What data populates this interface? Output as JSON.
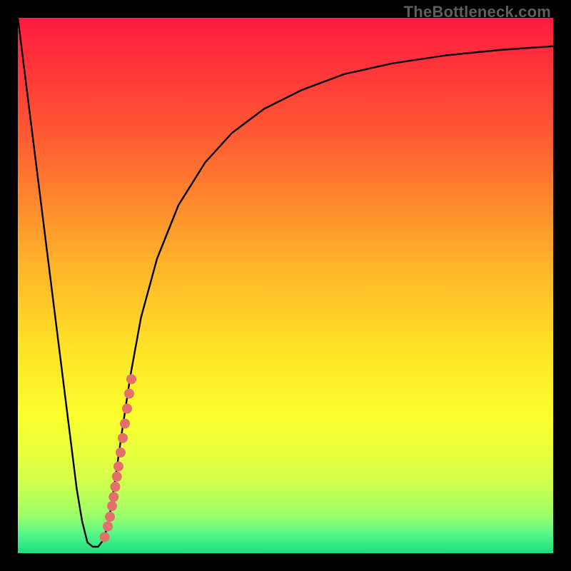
{
  "watermark": "TheBottleneck.com",
  "chart_data": {
    "type": "line",
    "title": "",
    "xlabel": "",
    "ylabel": "",
    "xlim": [
      0,
      100
    ],
    "ylim": [
      0,
      100
    ],
    "grid": false,
    "legend": false,
    "gradient_stops": [
      {
        "offset": 0.0,
        "color": "#ff1a3f"
      },
      {
        "offset": 0.22,
        "color": "#ff5a33"
      },
      {
        "offset": 0.45,
        "color": "#ffb02a"
      },
      {
        "offset": 0.62,
        "color": "#ffe326"
      },
      {
        "offset": 0.75,
        "color": "#fbff2e"
      },
      {
        "offset": 0.86,
        "color": "#d7ff4a"
      },
      {
        "offset": 0.93,
        "color": "#9cff69"
      },
      {
        "offset": 0.965,
        "color": "#55f58a"
      },
      {
        "offset": 1.0,
        "color": "#18e07d"
      }
    ],
    "series": [
      {
        "name": "bottleneck-curve",
        "color": "#000000",
        "x": [
          0.0,
          2.0,
          4.0,
          6.0,
          8.0,
          10.0,
          11.0,
          12.0,
          13.0,
          14.0,
          15.0,
          16.0,
          17.0,
          18.0,
          19.5,
          21.0,
          23.0,
          26.0,
          30.0,
          35.0,
          40.0,
          46.0,
          53.0,
          61.0,
          70.0,
          80.0,
          90.0,
          100.0
        ],
        "y": [
          100.0,
          84.0,
          68.0,
          52.0,
          36.0,
          20.0,
          12.0,
          6.0,
          2.0,
          1.2,
          1.2,
          2.5,
          6.0,
          12.5,
          23.0,
          33.0,
          44.0,
          55.0,
          65.0,
          73.0,
          78.5,
          83.0,
          86.5,
          89.5,
          91.5,
          93.0,
          94.0,
          94.7
        ]
      }
    ],
    "scatter": {
      "name": "highlight-dots",
      "color": "#e2716c",
      "points": [
        {
          "x": 16.2,
          "y": 3.0
        },
        {
          "x": 16.8,
          "y": 5.0
        },
        {
          "x": 17.2,
          "y": 6.8
        },
        {
          "x": 17.6,
          "y": 8.8
        },
        {
          "x": 17.9,
          "y": 10.5
        },
        {
          "x": 18.2,
          "y": 12.4
        },
        {
          "x": 18.5,
          "y": 14.3
        },
        {
          "x": 18.8,
          "y": 16.2
        },
        {
          "x": 19.2,
          "y": 18.8
        },
        {
          "x": 19.6,
          "y": 21.5
        },
        {
          "x": 20.0,
          "y": 24.2
        },
        {
          "x": 20.4,
          "y": 27.0
        },
        {
          "x": 20.8,
          "y": 29.8
        },
        {
          "x": 21.2,
          "y": 32.5
        }
      ]
    }
  }
}
